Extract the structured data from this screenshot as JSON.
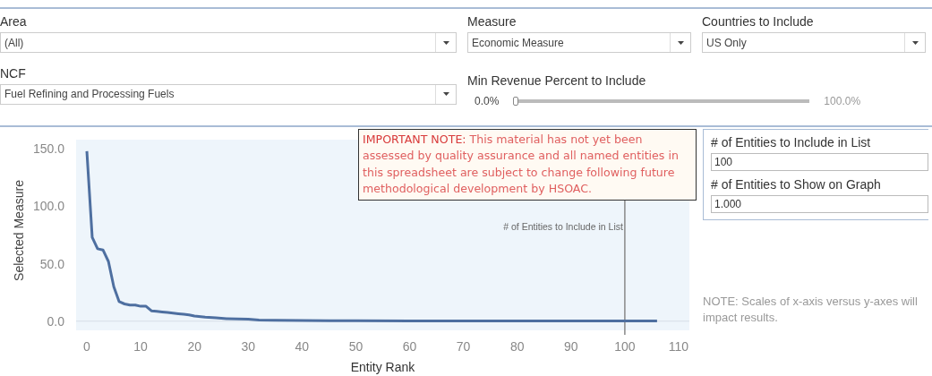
{
  "filters": [
    {
      "label": "Area",
      "value": "(All)"
    },
    {
      "label": "Measure",
      "value": "Economic Measure"
    },
    {
      "label": "Countries to Include",
      "value": "US Only"
    },
    {
      "label": "NCF",
      "value": "Fuel Refining and Processing Fuels"
    }
  ],
  "slider": {
    "label": "Min Revenue Percent to Include",
    "min_label": "0.0%",
    "max_label": "100.0%",
    "level": 0
  },
  "note_box": "**IMPORTANT NOTE:** This material has not yet been assessed by quality assurance and all named entities in this spreadsheet are subject to change following future methodological development by HSOAC.",
  "parameters": [
    {
      "label": "# of Entities to Include in List",
      "value": "100"
    },
    {
      "label": "# of Entities to Show on Graph",
      "value": "1.000"
    }
  ],
  "scale_note": "NOTE: Scales of x-axis versus y-axes will impact results.",
  "chart": {
    "chart_data": {
      "type": "line",
      "xlabel": "Entity Rank",
      "ylabel": "Selected Measure",
      "x": [
        0,
        1,
        2,
        3,
        4,
        5,
        6,
        7,
        8,
        9,
        10,
        11,
        12,
        13,
        14,
        15,
        16,
        17,
        18,
        19,
        20,
        22,
        24,
        26,
        28,
        30,
        32,
        35,
        40,
        45,
        50,
        60,
        70,
        80,
        90,
        100,
        106
      ],
      "series": [
        {
          "color": "#4e6fa0",
          "values": [
            148,
            73,
            63,
            62,
            52,
            30,
            17,
            15,
            14,
            14,
            13,
            13,
            9,
            8.5,
            8,
            7.5,
            7,
            6.5,
            6,
            5.5,
            4.5,
            3.5,
            3,
            2.2,
            2,
            1.7,
            1,
            0.8,
            0.5,
            0.4,
            0.3,
            0.2,
            0.2,
            0.1,
            0.1,
            0.1,
            0.1
          ]
        }
      ],
      "xlim": [
        -2,
        112
      ],
      "ylim": [
        -8,
        158
      ],
      "xticks": [
        0,
        10,
        20,
        30,
        40,
        50,
        60,
        70,
        80,
        90,
        100,
        110
      ],
      "yticks": [
        {
          "value": 0,
          "label": "0.0"
        },
        {
          "value": 50,
          "label": "50.0"
        },
        {
          "value": 100,
          "label": "100.0"
        },
        {
          "value": 150,
          "label": "150.0"
        }
      ],
      "ref_lines": [
        {
          "axis": "x",
          "value": 100,
          "label": "# of Entities to Include in List"
        }
      ]
    }
  }
}
